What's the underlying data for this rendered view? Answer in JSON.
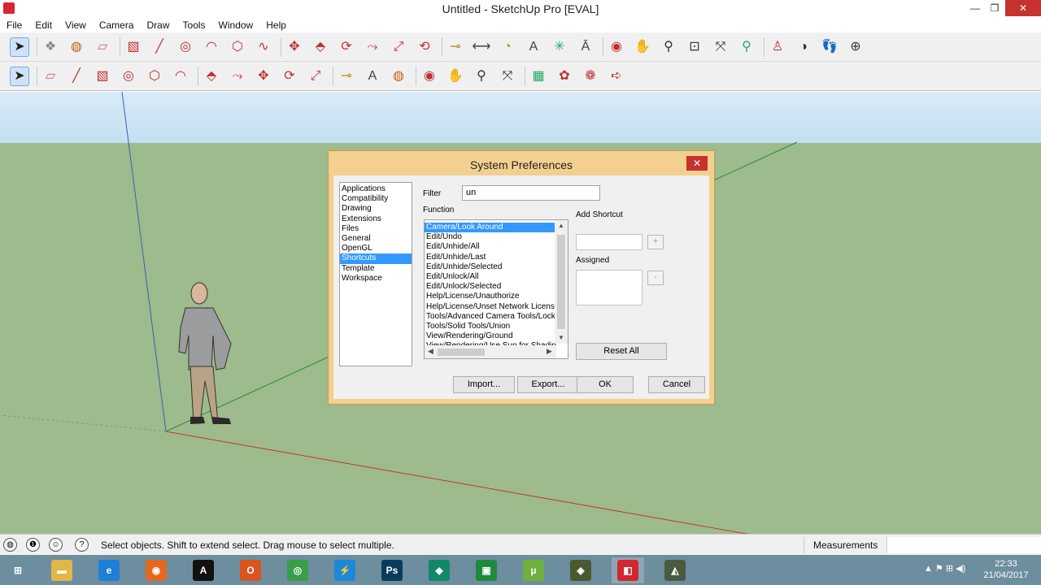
{
  "window": {
    "title": "Untitled - SketchUp Pro [EVAL]",
    "minimize": "—",
    "restore": "❐",
    "close": "✕"
  },
  "menu": [
    "File",
    "Edit",
    "View",
    "Camera",
    "Draw",
    "Tools",
    "Window",
    "Help"
  ],
  "toolbar1_icons": [
    {
      "name": "select-icon",
      "glyph": "➤",
      "color": "#222"
    },
    {
      "name": "component-icon",
      "glyph": "❖",
      "color": "#888"
    },
    {
      "name": "paint-bucket-icon",
      "glyph": "◍",
      "color": "#c06010"
    },
    {
      "name": "eraser-icon",
      "glyph": "▱",
      "color": "#d4607a"
    },
    {
      "name": "rectangle-icon",
      "glyph": "▧",
      "color": "#c03030"
    },
    {
      "name": "line-icon",
      "glyph": "╱",
      "color": "#c03030"
    },
    {
      "name": "circle-icon",
      "glyph": "◎",
      "color": "#c03030"
    },
    {
      "name": "arc-icon",
      "glyph": "◠",
      "color": "#c03030"
    },
    {
      "name": "polygon-icon",
      "glyph": "⬡",
      "color": "#c03030"
    },
    {
      "name": "freehand-icon",
      "glyph": "∿",
      "color": "#c03030"
    },
    {
      "name": "move-icon",
      "glyph": "✥",
      "color": "#c03030"
    },
    {
      "name": "push-pull-icon",
      "glyph": "⬘",
      "color": "#c03030"
    },
    {
      "name": "rotate-icon",
      "glyph": "⟳",
      "color": "#c03030"
    },
    {
      "name": "follow-me-icon",
      "glyph": "⤳",
      "color": "#c03030"
    },
    {
      "name": "scale-icon",
      "glyph": "⤢",
      "color": "#c03030"
    },
    {
      "name": "offset-icon",
      "glyph": "⟲",
      "color": "#c03030"
    },
    {
      "name": "tape-measure-icon",
      "glyph": "⊸",
      "color": "#b08a10"
    },
    {
      "name": "dimension-icon",
      "glyph": "⟷",
      "color": "#444"
    },
    {
      "name": "protractor-icon",
      "glyph": "◔",
      "color": "#b0a010"
    },
    {
      "name": "text-icon",
      "glyph": "A",
      "color": "#444"
    },
    {
      "name": "axes-icon",
      "glyph": "✳",
      "color": "#2a6"
    },
    {
      "name": "3d-text-icon",
      "glyph": "Ā",
      "color": "#444"
    },
    {
      "name": "orbit-icon",
      "glyph": "◉",
      "color": "#c03030"
    },
    {
      "name": "pan-icon",
      "glyph": "✋",
      "color": "#444"
    },
    {
      "name": "zoom-icon",
      "glyph": "⚲",
      "color": "#333"
    },
    {
      "name": "zoom-window-icon",
      "glyph": "⊡",
      "color": "#333"
    },
    {
      "name": "zoom-extents-icon",
      "glyph": "⤧",
      "color": "#333"
    },
    {
      "name": "previous-view-icon",
      "glyph": "⚲",
      "color": "#2a6"
    },
    {
      "name": "position-camera-icon",
      "glyph": "♙",
      "color": "#c03030"
    },
    {
      "name": "look-around-icon",
      "glyph": "◑",
      "color": "#333"
    },
    {
      "name": "walk-icon",
      "glyph": "👣",
      "color": "#333"
    },
    {
      "name": "section-plane-icon",
      "glyph": "⊕",
      "color": "#333"
    }
  ],
  "toolbar2_icons": [
    {
      "name": "select-icon",
      "glyph": "➤",
      "color": "#222"
    },
    {
      "name": "eraser-icon",
      "glyph": "▱",
      "color": "#d4607a"
    },
    {
      "name": "line-icon",
      "glyph": "╱",
      "color": "#c03030"
    },
    {
      "name": "rectangle-icon",
      "glyph": "▧",
      "color": "#c03030"
    },
    {
      "name": "circle-icon",
      "glyph": "◎",
      "color": "#c03030"
    },
    {
      "name": "polygon-icon",
      "glyph": "⬡",
      "color": "#c03030"
    },
    {
      "name": "arc-icon",
      "glyph": "◠",
      "color": "#c03030"
    },
    {
      "name": "push-pull-icon",
      "glyph": "⬘",
      "color": "#c03030"
    },
    {
      "name": "follow-me-icon",
      "glyph": "⤳",
      "color": "#c03030"
    },
    {
      "name": "move-icon",
      "glyph": "✥",
      "color": "#c03030"
    },
    {
      "name": "rotate-icon",
      "glyph": "⟳",
      "color": "#c03030"
    },
    {
      "name": "scale-icon",
      "glyph": "⤢",
      "color": "#c03030"
    },
    {
      "name": "tape-measure-icon",
      "glyph": "⊸",
      "color": "#b08a10"
    },
    {
      "name": "text-icon",
      "glyph": "A",
      "color": "#444"
    },
    {
      "name": "paint-bucket-icon",
      "glyph": "◍",
      "color": "#c06010"
    },
    {
      "name": "orbit-icon",
      "glyph": "◉",
      "color": "#c03030"
    },
    {
      "name": "pan-icon",
      "glyph": "✋",
      "color": "#444"
    },
    {
      "name": "zoom-icon",
      "glyph": "⚲",
      "color": "#333"
    },
    {
      "name": "zoom-extents-icon",
      "glyph": "⤧",
      "color": "#333"
    },
    {
      "name": "3d-warehouse-icon",
      "glyph": "▦",
      "color": "#2a6"
    },
    {
      "name": "extension-warehouse-icon",
      "glyph": "✿",
      "color": "#c03030"
    },
    {
      "name": "share-model-icon",
      "glyph": "❁",
      "color": "#c03030"
    },
    {
      "name": "send-to-layout-icon",
      "glyph": "➪",
      "color": "#c03030"
    }
  ],
  "dialog": {
    "title": "System Preferences",
    "close": "✕",
    "categories": [
      "Applications",
      "Compatibility",
      "Drawing",
      "Extensions",
      "Files",
      "General",
      "OpenGL",
      "Shortcuts",
      "Template",
      "Workspace"
    ],
    "selected_category": "Shortcuts",
    "filter_label": "Filter",
    "filter_value": "un",
    "function_label": "Function",
    "functions": [
      "Camera/Look Around",
      "Edit/Undo",
      "Edit/Unhide/All",
      "Edit/Unhide/Last",
      "Edit/Unhide/Selected",
      "Edit/Unlock/All",
      "Edit/Unlock/Selected",
      "Help/License/Unauthorize",
      "Help/License/Unset Network License",
      "Tools/Advanced Camera Tools/Lock",
      "Tools/Solid Tools/Union",
      "View/Rendering/Ground",
      "View/Rendering/Use Sun for Shading"
    ],
    "selected_function": "Camera/Look Around",
    "add_shortcut_label": "Add Shortcut",
    "add_button": "+",
    "assigned_label": "Assigned",
    "remove_button": "-",
    "reset_all": "Reset All",
    "import": "Import...",
    "export": "Export...",
    "ok": "OK",
    "cancel": "Cancel"
  },
  "statusbar": {
    "icons": [
      {
        "name": "geo-location-icon",
        "glyph": "◍"
      },
      {
        "name": "credits-icon",
        "glyph": "❶"
      },
      {
        "name": "sign-in-icon",
        "glyph": "☺"
      },
      {
        "name": "help-icon",
        "glyph": "?"
      }
    ],
    "text": "Select objects. Shift to extend select. Drag mouse to select multiple.",
    "measurements_label": "Measurements",
    "measurements_value": ""
  },
  "taskbar": {
    "apps": [
      {
        "name": "start-icon",
        "glyph": "⊞",
        "color": "#6d8e9e"
      },
      {
        "name": "file-explorer-icon",
        "glyph": "▬",
        "color": "#e3b64a"
      },
      {
        "name": "internet-explorer-icon",
        "glyph": "e",
        "color": "#1d7fd6"
      },
      {
        "name": "firefox-icon",
        "glyph": "◉",
        "color": "#e4671d"
      },
      {
        "name": "autocad-icon",
        "glyph": "A",
        "color": "#111"
      },
      {
        "name": "office-icon",
        "glyph": "O",
        "color": "#d9541e"
      },
      {
        "name": "chrome-icon",
        "glyph": "◎",
        "color": "#3a9d4a"
      },
      {
        "name": "bolt-app-icon",
        "glyph": "⚡",
        "color": "#1e88d8"
      },
      {
        "name": "photoshop-icon",
        "glyph": "Ps",
        "color": "#0b3b5c"
      },
      {
        "name": "tekla-icon",
        "glyph": "◆",
        "color": "#12876a"
      },
      {
        "name": "project-icon",
        "glyph": "▣",
        "color": "#1e8a3c"
      },
      {
        "name": "utorrent-icon",
        "glyph": "µ",
        "color": "#6fb03c"
      },
      {
        "name": "layout-icon",
        "glyph": "◈",
        "color": "#4a5a30"
      },
      {
        "name": "sketchup-icon",
        "glyph": "◧",
        "color": "#d3262e"
      },
      {
        "name": "style-builder-icon",
        "glyph": "◭",
        "color": "#4a5a40"
      }
    ],
    "active_app": "sketchup-icon",
    "tray": "▲  ⚑  ⊞  ◀)",
    "time": "22:33",
    "date": "21/04/2017"
  }
}
